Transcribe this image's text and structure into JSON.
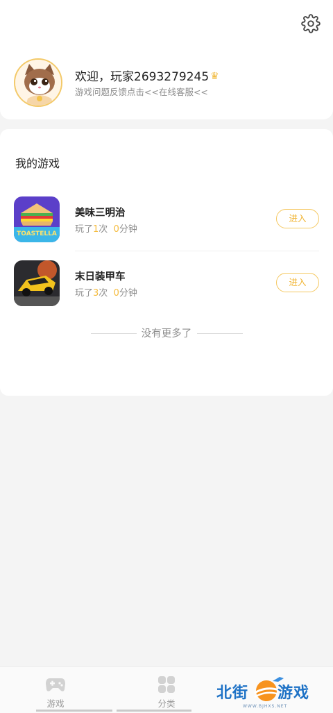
{
  "profile": {
    "welcome_text": "欢迎，玩家2693279245",
    "crown_icon": "crown-icon",
    "feedback_text": "游戏问题反馈点击<<在线客服<<",
    "avatar": "cat-avatar"
  },
  "settings_icon": "gear-icon",
  "my_games": {
    "title": "我的游戏",
    "items": [
      {
        "name": "美味三明治",
        "icon": "sandwich-game-icon",
        "icon_text": "TOASTELLA",
        "stats_prefix": "玩了",
        "play_count": "1",
        "count_unit": "次",
        "minutes": "0",
        "minute_unit": "分钟",
        "button_label": "进入"
      },
      {
        "name": "末日装甲车",
        "icon": "armored-car-game-icon",
        "stats_prefix": "玩了",
        "play_count": "3",
        "count_unit": "次",
        "minutes": "0",
        "minute_unit": "分钟",
        "button_label": "进入"
      }
    ],
    "end_text": "没有更多了"
  },
  "tabbar": {
    "tabs": [
      {
        "label": "游戏",
        "icon": "gamepad-icon"
      },
      {
        "label": "分类",
        "icon": "grid-icon"
      },
      {
        "label": "",
        "icon": "user-icon"
      }
    ]
  },
  "watermark": {
    "text_left": "北街",
    "text_right": "游戏",
    "url": "WWW.BJHXS.NET"
  },
  "colors": {
    "accent": "#f5bb3c",
    "text_primary": "#222222",
    "text_secondary": "#8d8d8d",
    "background": "#f4f4f4"
  }
}
